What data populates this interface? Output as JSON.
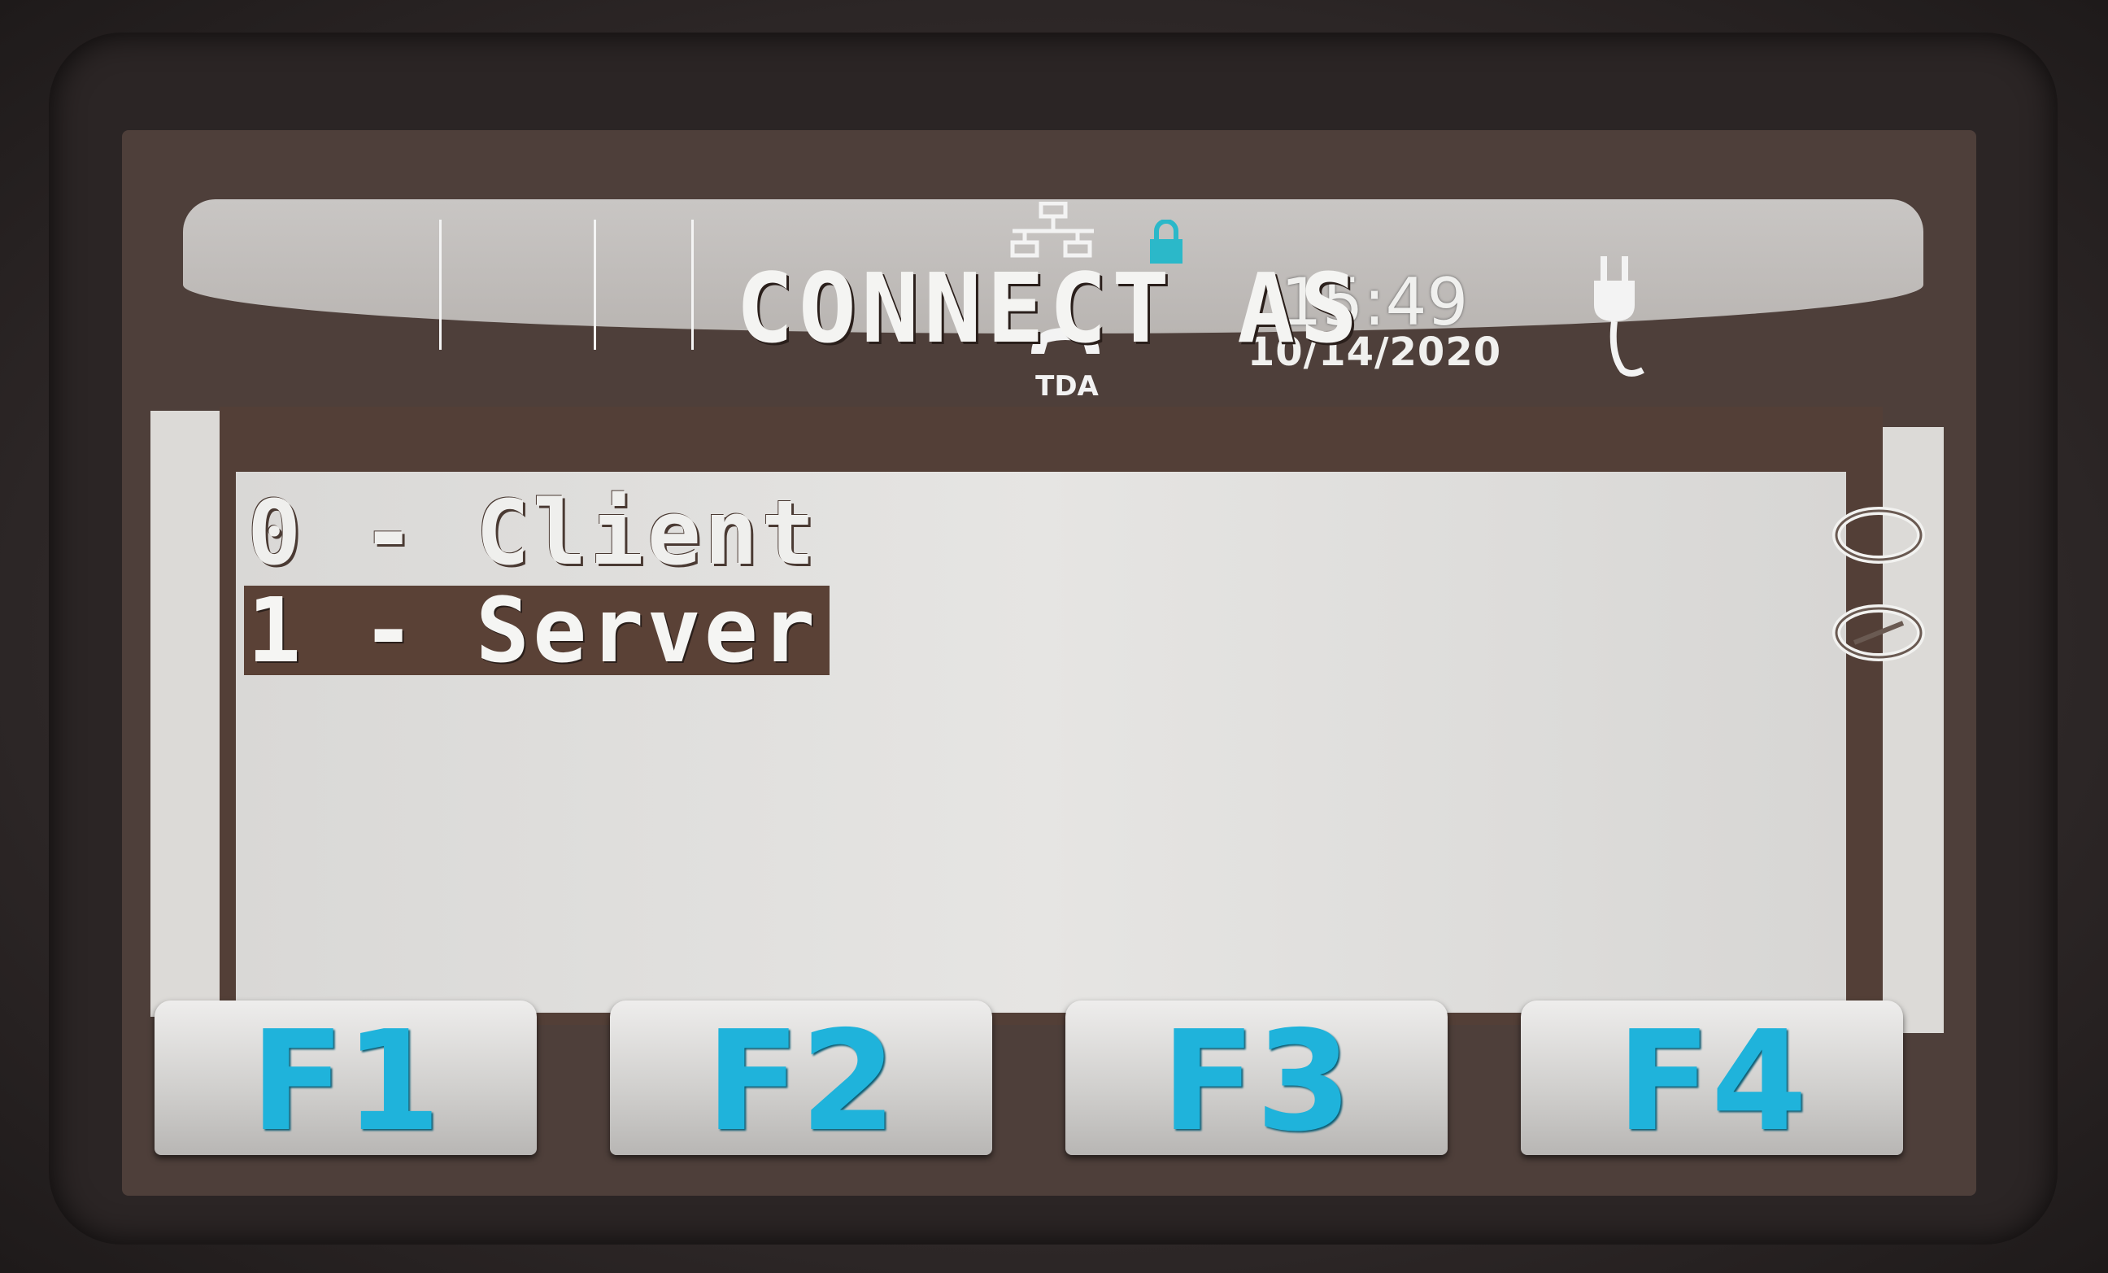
{
  "status_bar": {
    "time": "15:49",
    "date": "10/14/2020",
    "line_label": "TDA",
    "icons": [
      "network-icon",
      "lock-icon",
      "handset-icon",
      "plug-icon"
    ]
  },
  "dialog": {
    "title": "CONNECT AS",
    "options": [
      {
        "label": "0 - Client",
        "selected": false
      },
      {
        "label": "1 - Server",
        "selected": true
      }
    ]
  },
  "function_keys": [
    "F1",
    "F2",
    "F3",
    "F4"
  ],
  "colors": {
    "panel": "#533f37",
    "list_background": "#e0dfdd",
    "fkey_text": "#1fb3db",
    "lock_accent": "#2bb8c9"
  }
}
